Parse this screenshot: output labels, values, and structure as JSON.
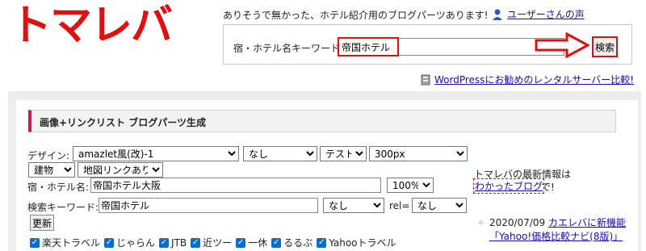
{
  "header": {
    "logo": "トマレバ",
    "tagline": "ありそうで無かった、ホテル紹介用のブログパーツあります!",
    "voice_link": "ユーザーさんの声"
  },
  "search": {
    "label": "宿・ホテル名キーワード:",
    "value": "帝国ホテル",
    "button": "検索"
  },
  "promo_link": "WordPressにお勧めのレンタルサーバー比較!",
  "section": {
    "title": "画像+リンクリスト ブログパーツ生成"
  },
  "form": {
    "design_label": "デザイン:",
    "design_value": "amazlet風(改)-1",
    "select2_value": "なし",
    "select3_value": "テスト",
    "size_value": "300px",
    "building_value": "建物",
    "map_value": "地図リンクあり",
    "hotel_label": "宿・ホテル名:",
    "hotel_value": "帝国ホテル大阪",
    "percent_value": "100%",
    "keyword_label": "検索キーワード:",
    "keyword_value": "帝国ホテル",
    "select4_value": "なし",
    "rel_label": "rel=",
    "rel_value": "なし",
    "update_button": "更新",
    "checkboxes": [
      "楽天トラベル",
      "じゃらん",
      "JTB",
      "近ツー",
      "一休",
      "るるぶ",
      "Yahooトラベル"
    ]
  },
  "news": {
    "title": "トマレバの最新情報は",
    "link": "わかったブログ",
    "after": "で!",
    "bullet": "◦",
    "item_date": "2020/07/09",
    "item_link": "カエレバに新機能「Yahoo!価格比較ナビ(8版)」"
  },
  "colors": {
    "logo_red": "#e01010",
    "link_blue": "#1a0dab",
    "section_accent": "#c41a58",
    "checkbox_blue": "#0a6ed1"
  }
}
